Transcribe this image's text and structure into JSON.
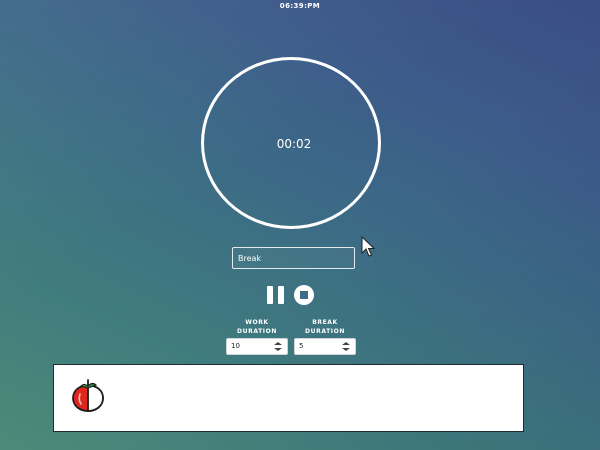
{
  "statusbar": {
    "time": "06:39:PM"
  },
  "timer": {
    "display": "00:02"
  },
  "mode": {
    "value": "Break"
  },
  "controls": {
    "pause_icon": "pause-icon",
    "stop_icon": "stop-icon"
  },
  "durations": [
    {
      "label_line1": "WORK",
      "label_line2": "DURATION",
      "value": "10"
    },
    {
      "label_line1": "BREAK",
      "label_line2": "DURATION",
      "value": "5"
    }
  ],
  "history": {
    "icon": "tomato-icon"
  },
  "colors": {
    "accent": "#ffffff",
    "tomato_red": "#e0261c",
    "stem_green": "#2f9b3a"
  }
}
